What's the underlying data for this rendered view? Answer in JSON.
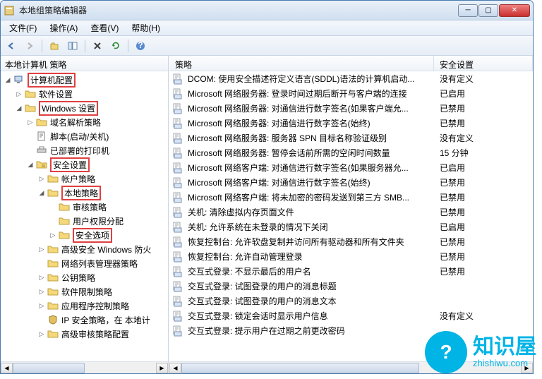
{
  "window": {
    "title": "本地组策略编辑器"
  },
  "menu": {
    "file": "文件(F)",
    "action": "操作(A)",
    "view": "查看(V)",
    "help": "帮助(H)"
  },
  "tree_header": "本地计算机 策略",
  "tree": {
    "computer_config": "计算机配置",
    "software": "软件设置",
    "windows": "Windows 设置",
    "dns": "域名解析策略",
    "scripts": "脚本(启动/关机)",
    "printers": "已部署的打印机",
    "security": "安全设置",
    "account": "帐户策略",
    "local": "本地策略",
    "audit": "审核策略",
    "user_rights": "用户权限分配",
    "sec_options": "安全选项",
    "firewall": "高级安全 Windows 防火",
    "netlist": "网络列表管理器策略",
    "pubkey": "公钥策略",
    "softrestrict": "软件限制策略",
    "appctrl": "应用程序控制策略",
    "ipsec": "IP 安全策略，在 本地计",
    "advaudit": "高级审核策略配置"
  },
  "list_header": {
    "policy": "策略",
    "setting": "安全设置"
  },
  "policies": [
    {
      "name": "DCOM: 使用安全描述符定义语言(SDDL)语法的计算机启动...",
      "value": "没有定义"
    },
    {
      "name": "Microsoft 网络服务器: 登录时间过期后断开与客户端的连接",
      "value": "已启用"
    },
    {
      "name": "Microsoft 网络服务器: 对通信进行数字签名(如果客户端允...",
      "value": "已禁用"
    },
    {
      "name": "Microsoft 网络服务器: 对通信进行数字签名(始终)",
      "value": "已禁用"
    },
    {
      "name": "Microsoft 网络服务器: 服务器 SPN 目标名称验证级别",
      "value": "没有定义"
    },
    {
      "name": "Microsoft 网络服务器: 暂停会话前所需的空闲时间数量",
      "value": "15 分钟"
    },
    {
      "name": "Microsoft 网络客户端: 对通信进行数字签名(如果服务器允...",
      "value": "已启用"
    },
    {
      "name": "Microsoft 网络客户端: 对通信进行数字签名(始终)",
      "value": "已禁用"
    },
    {
      "name": "Microsoft 网络客户端: 将未加密的密码发送到第三方 SMB...",
      "value": "已禁用"
    },
    {
      "name": "关机: 清除虚拟内存页面文件",
      "value": "已禁用"
    },
    {
      "name": "关机: 允许系统在未登录的情况下关闭",
      "value": "已启用"
    },
    {
      "name": "恢复控制台: 允许软盘复制并访问所有驱动器和所有文件夹",
      "value": "已禁用"
    },
    {
      "name": "恢复控制台: 允许自动管理登录",
      "value": "已禁用"
    },
    {
      "name": "交互式登录: 不显示最后的用户名",
      "value": "已禁用"
    },
    {
      "name": "交互式登录: 试图登录的用户的消息标题",
      "value": ""
    },
    {
      "name": "交互式登录: 试图登录的用户的消息文本",
      "value": ""
    },
    {
      "name": "交互式登录: 锁定会话时显示用户信息",
      "value": "没有定义"
    },
    {
      "name": "交互式登录: 提示用户在过期之前更改密码",
      "value": ""
    }
  ],
  "watermark": {
    "title": "知识屋",
    "url": "zhishiwu.com",
    "badge": "?"
  }
}
